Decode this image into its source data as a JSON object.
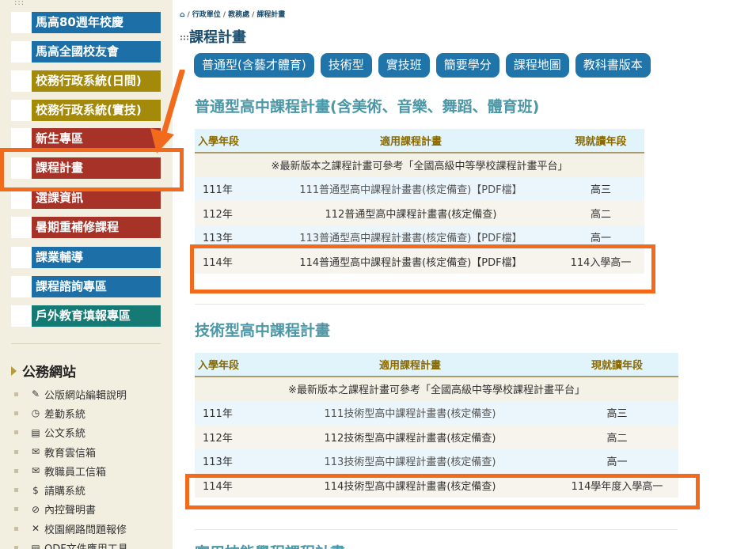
{
  "sidebar": {
    "dots": ":::",
    "buttons": [
      {
        "label": "馬高80週年校慶"
      },
      {
        "label": "馬高全國校友會"
      },
      {
        "label": "校務行政系統(日間)"
      },
      {
        "label": "校務行政系統(實技)"
      },
      {
        "label": "新生專區"
      },
      {
        "label": "課程計畫"
      },
      {
        "label": "選課資訊"
      },
      {
        "label": "暑期重補修課程"
      },
      {
        "label": "課業輔導"
      },
      {
        "label": "課程諮詢專區"
      },
      {
        "label": "戶外教育填報專區"
      }
    ],
    "official_title": "公務網站",
    "links": [
      {
        "label": "公版網站編輯說明",
        "icon": "edit-icon"
      },
      {
        "label": "差勤系統",
        "icon": "clock-icon"
      },
      {
        "label": "公文系統",
        "icon": "document-icon"
      },
      {
        "label": "教育雲信箱",
        "icon": "mail-icon"
      },
      {
        "label": "教職員工信箱",
        "icon": "mail-icon"
      },
      {
        "label": "請購系統",
        "icon": "dollar-document-icon"
      },
      {
        "label": "內控聲明書",
        "icon": "paperclip-icon"
      },
      {
        "label": "校園網路問題報修",
        "icon": "tools-icon"
      },
      {
        "label": "ODF文件應用工具",
        "icon": "document-icon"
      }
    ]
  },
  "breadcrumb": {
    "items": [
      "行政單位",
      "教務處",
      "課程計畫"
    ],
    "separator": "/"
  },
  "page": {
    "title_dots": ":::",
    "title": "課程計畫"
  },
  "tabs": [
    "普通型(含藝才體育)",
    "技術型",
    "實技班",
    "簡要學分",
    "課程地圖",
    "教科書版本"
  ],
  "section_general": {
    "title": "普通型高中課程計畫(含美術、音樂、舞蹈、體育班)",
    "headers": [
      "入學年段",
      "適用課程計畫",
      "現就讀年段"
    ],
    "note": "※最新版本之課程計畫可參考「全國高級中等學校課程計畫平台」",
    "rows": [
      [
        "111年",
        "111普通型高中課程計畫書(核定備查)【PDF檔】",
        "高三"
      ],
      [
        "112年",
        "112普通型高中課程計畫書(核定備查)",
        "高二"
      ],
      [
        "113年",
        "113普通型高中課程計畫書(核定備查)【PDF檔】",
        "高一"
      ],
      [
        "114年",
        "114普通型高中課程計畫書(核定備查)【PDF檔】",
        "114入學高一"
      ]
    ]
  },
  "section_tech": {
    "title": "技術型高中課程計畫",
    "headers": [
      "入學年段",
      "適用課程計畫",
      "現就讀年段"
    ],
    "note": "※最新版本之課程計畫可參考「全國高級中等學校課程計畫平台」",
    "rows": [
      [
        "111年",
        "111技術型高中課程計畫書(核定備查)",
        "高三"
      ],
      [
        "112年",
        "112技術型高中課程計畫書(核定備查)",
        "高二"
      ],
      [
        "113年",
        "113技術型高中課程計畫書(核定備查)",
        "高一"
      ],
      [
        "114年",
        "114技術型高中課程計畫書(核定備查)",
        "114學年度入學高一"
      ]
    ]
  },
  "section_next": {
    "title": "實用技能學程課程計畫"
  },
  "colors": {
    "highlight": "#f26a1b",
    "blue_button": "#1d6fa8",
    "gold_button": "#a48a0a",
    "red_button": "#a63228",
    "teal_button": "#157a73",
    "tab_blue": "#1f74a9",
    "section_title": "#4c97a6"
  }
}
